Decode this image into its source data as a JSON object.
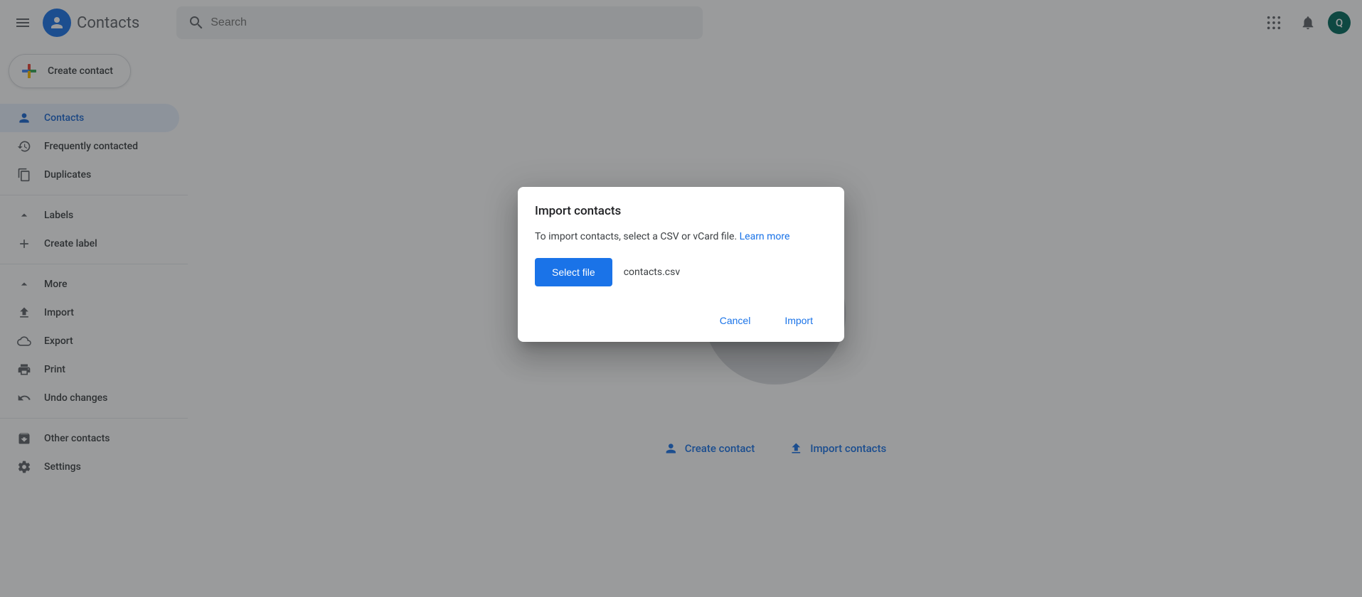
{
  "header": {
    "app_title": "Contacts",
    "search_placeholder": "Search",
    "avatar_letter": "Q"
  },
  "create_button": "Create contact",
  "sidebar": {
    "contacts": "Contacts",
    "frequent": "Frequently contacted",
    "duplicates": "Duplicates",
    "labels_header": "Labels",
    "create_label": "Create label",
    "more_header": "More",
    "import": "Import",
    "export": "Export",
    "print": "Print",
    "undo": "Undo changes",
    "other": "Other contacts",
    "settings": "Settings"
  },
  "main": {
    "create_contact": "Create contact",
    "import_contacts": "Import contacts"
  },
  "dialog": {
    "title": "Import contacts",
    "body_text": "To import contacts, select a CSV or vCard file. ",
    "learn_more": "Learn more",
    "select_file": "Select file",
    "file_name": "contacts.csv",
    "cancel": "Cancel",
    "import": "Import"
  }
}
